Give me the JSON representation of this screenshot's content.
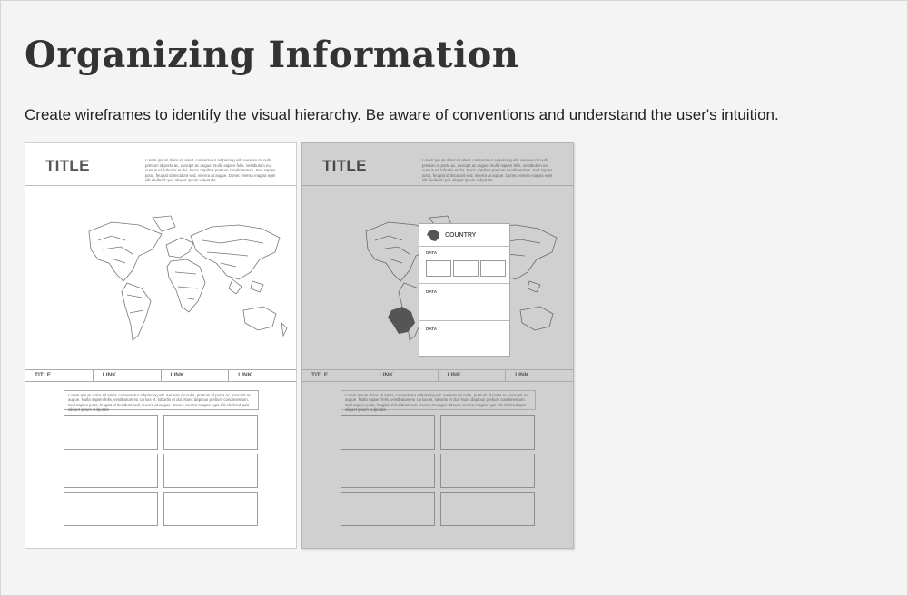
{
  "page": {
    "title": "Organizing Information",
    "subtitle": "Create wireframes to identify the visual hierarchy. Be aware of conventions and understand the user's intuition."
  },
  "wireframes": [
    {
      "title": "TITLE",
      "header_text": "Lorem ipsum dolor sit amet, consectetur adipiscing elit. Aenean mi nulla, pretium id porta ac, suscipit ac augue. Nulla sapien felis, vestibulum eu cursus et, lobortis et dui. Nunc dapibus pretium condimentum. Sed sapien justo, feugiat id tincidunt sed, viverra at augue. Donec viverra magna eget elit eleifend quis aliquet ipsum vulputate.",
      "nav": [
        "TITLE",
        "LINK",
        "LINK",
        "LINK"
      ],
      "body_text": "Lorem ipsum dolor sit amet, consectetur adipiscing elit. Aenean mi nulla, pretium id porta ac, suscipit ac augue. Nulla sapien felis, vestibulum eu cursus et, lobortis et dui. Nunc dapibus pretium condimentum. Sed sapien justo, feugiat id tincidunt sed, viverra at augue. Donec viverra magna eget elit eleifend quis aliquet ipsum vulputate."
    },
    {
      "title": "TITLE",
      "header_text": "Lorem ipsum dolor sit amet, consectetur adipiscing elit. Aenean mi nulla, pretium id porta ac, suscipit ac augue. Nulla sapien felis, vestibulum eu cursus et, lobortis et dui. Nunc dapibus pretium condimentum. Sed sapien justo, feugiat id tincidunt sed, viverra at augue. Donec viverra magna eget elit eleifend quis aliquet ipsum vulputate.",
      "nav": [
        "TITLE",
        "LINK",
        "LINK",
        "LINK"
      ],
      "body_text": "Lorem ipsum dolor sit amet, consectetur adipiscing elit. Aenean mi nulla, pretium id porta ac, suscipit ac augue. Nulla sapien felis, vestibulum eu cursus et, lobortis et dui. Nunc dapibus pretium condimentum. Sed sapien justo, feugiat id tincidunt sed, viverra at augue. Donec viverra magna eget elit eleifend quis aliquet ipsum vulputate.",
      "popup": {
        "country": "COUNTRY",
        "labels": [
          "DATA",
          "DATA",
          "DATA"
        ]
      }
    }
  ],
  "colors": {
    "background": "#f4f4f4",
    "overlay_gray": "#d0d0d0",
    "highlight_country": "#555555"
  }
}
